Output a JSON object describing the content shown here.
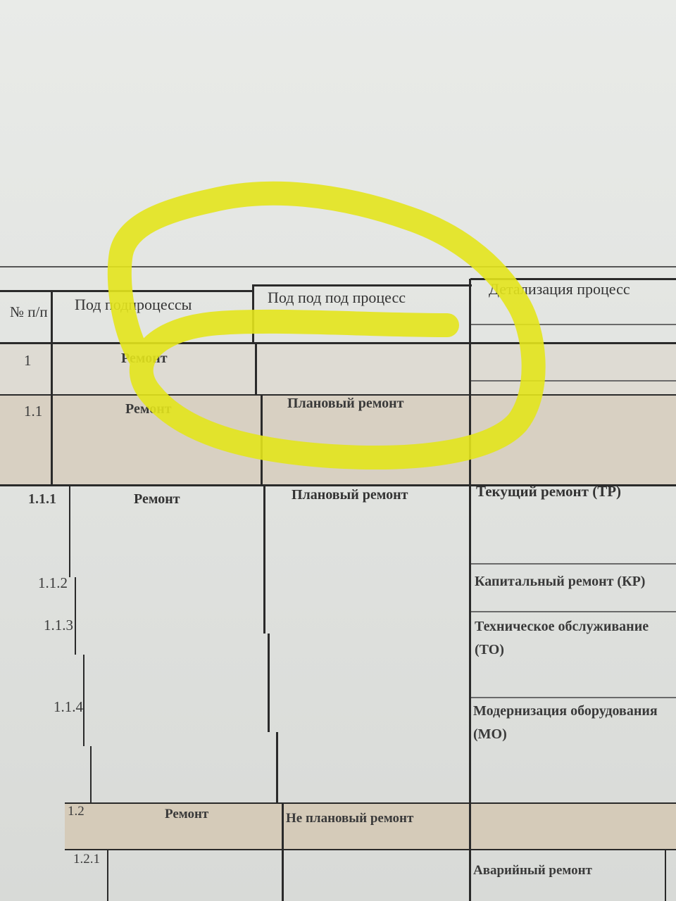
{
  "header": {
    "num": "№ п/п",
    "col1": "Под подпроцессы",
    "col2": "Под под под процесс",
    "col3": "Детализация процесс"
  },
  "rows": [
    {
      "num": "1",
      "sub": "Ремонт",
      "proc": "",
      "detail": ""
    },
    {
      "num": "1.1",
      "sub": "Ремонт",
      "proc": "Плановый ремонт",
      "detail": ""
    },
    {
      "num": "1.1.1",
      "sub": "Ремонт",
      "proc": "Плановый ремонт",
      "detail": "Текущий ремонт (ТР)"
    },
    {
      "num": "1.1.2",
      "sub": "",
      "proc": "",
      "detail": "Капитальный ремонт (КР)"
    },
    {
      "num": "1.1.3",
      "sub": "",
      "proc": "",
      "detail": "Техническое обслуживание (ТО)"
    },
    {
      "num": "1.1.4",
      "sub": "",
      "proc": "",
      "detail": "Модернизация оборудования (МО)"
    },
    {
      "num": "1.2",
      "sub": "Ремонт",
      "proc": "Не плановый ремонт",
      "detail": ""
    },
    {
      "num": "1.2.1",
      "sub": "",
      "proc": "",
      "detail": "Аварийный ремонт"
    }
  ],
  "colors": {
    "highlight": "#e6e61a",
    "shaded_row": "#d9d2c4",
    "grid": "#2a2a2a"
  }
}
